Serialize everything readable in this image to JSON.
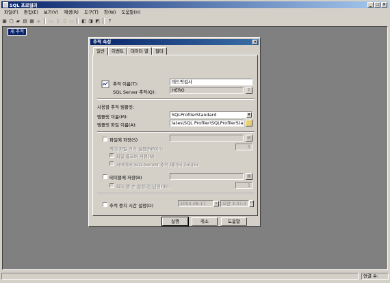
{
  "app": {
    "title": "SQL 프로필러",
    "menu": [
      "파일(F)",
      "편집(E)",
      "보기(V)",
      "재생(R)",
      "도구(T)",
      "창(W)",
      "도움말(H)"
    ],
    "status_right": "연결 수:"
  },
  "trace_window_label": "새 추적",
  "dialog": {
    "title": "추적 속성",
    "tabs": [
      "일반",
      "이벤트",
      "데이터 열",
      "필터"
    ],
    "trace_name_label": "추적 이름(T):",
    "trace_name_value": "데드락검사",
    "sql_server_label": "SQL Server 추적(Q):",
    "sql_server_value": "HERO",
    "template_section_label": "사용할 추적 템플릿:",
    "template_name_label": "템플릿 이름(M):",
    "template_name_value": "SQLProfilerStandard",
    "template_file_label": "템플릿 파일 이름(A):",
    "template_file_value": "lates\\SQL Profiler\\SQLProfilerStandard.tdf",
    "save_to_file_label": "파일에 저장(S)",
    "max_file_size_label": "최대 파일 크기 설정(MB)(I):",
    "max_file_size_value": "5",
    "file_rollover_label": "파일 롤오버 사용(N)",
    "server_process_label": "서버에서 SQL Server 추적 데이터 처리(E)",
    "save_to_table_label": "테이블에 저장(B)",
    "max_rows_label": "최대 행 수 설정(천 단위)(R):",
    "max_rows_value": "1",
    "stop_time_label": "추적 중지 시간 설정(D)",
    "stop_date_value": "2004-08-17",
    "stop_time_value": "오전  3:37:3",
    "buttons": {
      "run": "실행",
      "cancel": "취소",
      "help": "도움말"
    }
  }
}
